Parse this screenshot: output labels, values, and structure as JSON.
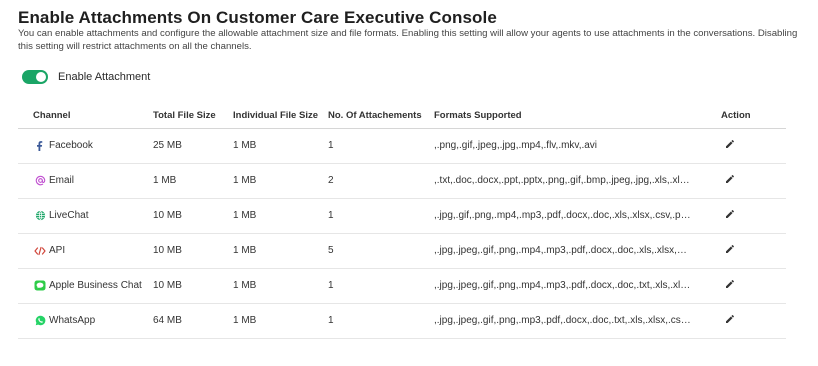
{
  "page": {
    "title": "Enable Attachments On Customer Care Executive Console",
    "description": "You can enable attachments and configure the allowable attachment size and file formats. Enabling this setting will allow your agents to use attachments in the conversations. Disabling this setting will restrict attachments on all the channels."
  },
  "toggle": {
    "label": "Enable Attachment",
    "state": "on",
    "color": "#1aa566"
  },
  "table": {
    "headers": {
      "channel": "Channel",
      "total": "Total File Size",
      "individual": "Individual File Size",
      "number": "No. Of Attachements",
      "formats": "Formats Supported",
      "action": "Action"
    },
    "rows": [
      {
        "channel": "Facebook",
        "icon": "facebook-icon",
        "icon_color": "#3b5998",
        "total": "25 MB",
        "individual": "1 MB",
        "number": "1",
        "formats": ",.png,.gif,.jpeg,.jpg,.mp4,.flv,.mkv,.avi"
      },
      {
        "channel": "Email",
        "icon": "at-sign-icon",
        "icon_color": "#c04fd0",
        "total": "1 MB",
        "individual": "1 MB",
        "number": "2",
        "formats": ",.txt,.doc,.docx,.ppt,.pptx,.png,.gif,.bmp,.jpeg,.jpg,.xls,.xl…"
      },
      {
        "channel": "LiveChat",
        "icon": "globe-icon",
        "icon_color": "#1aa566",
        "total": "10 MB",
        "individual": "1 MB",
        "number": "1",
        "formats": ",.jpg,.gif,.png,.mp4,.mp3,.pdf,.docx,.doc,.xls,.xlsx,.csv,.p…"
      },
      {
        "channel": "API",
        "icon": "code-icon",
        "icon_color": "#d0463b",
        "total": "10 MB",
        "individual": "1 MB",
        "number": "5",
        "formats": ",.jpg,.jpeg,.gif,.png,.mp4,.mp3,.pdf,.docx,.doc,.xls,.xlsx,…"
      },
      {
        "channel": "Apple Business Chat",
        "icon": "message-bubble-icon",
        "icon_color": "#2ecc48",
        "total": "10 MB",
        "individual": "1 MB",
        "number": "1",
        "formats": ",.jpg,.jpeg,.gif,.png,.mp4,.mp3,.pdf,.docx,.doc,.txt,.xls,.xl…"
      },
      {
        "channel": "WhatsApp",
        "icon": "whatsapp-icon",
        "icon_color": "#25d366",
        "total": "64 MB",
        "individual": "1 MB",
        "number": "1",
        "formats": ",.jpg,.jpeg,.gif,.png,.mp3,.pdf,.docx,.doc,.txt,.xls,.xlsx,.cs…"
      }
    ]
  }
}
